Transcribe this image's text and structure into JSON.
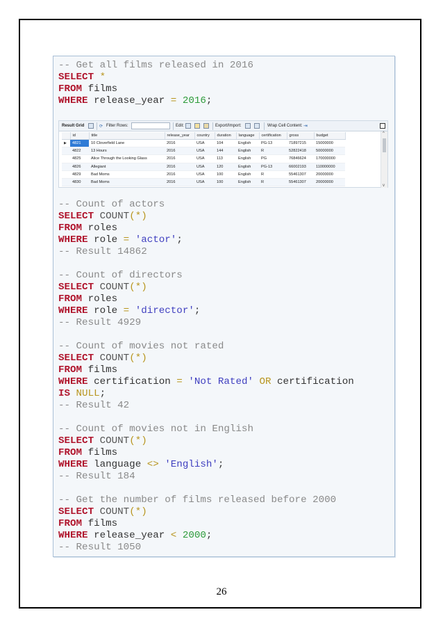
{
  "queries": [
    {
      "comment": "-- Get all films released in 2016"
    },
    {
      "comment": "-- Count of actors",
      "result": "-- Result 14862",
      "string": "'actor'"
    },
    {
      "comment": "-- Count of directors",
      "result": "-- Result 4929",
      "string": "'director'"
    },
    {
      "comment": "-- Count of movies not rated",
      "result": "-- Result 42",
      "string": "'Not Rated'"
    },
    {
      "comment": "-- Count of movies not in English",
      "result": "-- Result 184",
      "string": "'English'"
    },
    {
      "comment": "-- Get the number of films released before 2000",
      "result": "-- Result 1050"
    }
  ],
  "keywords": {
    "select": "SELECT",
    "from": "FROM",
    "where": "WHERE",
    "is": "IS",
    "count": "COUNT",
    "or": "OR",
    "null": "NULL",
    "star": "*"
  },
  "identifiers": {
    "films": "films",
    "roles": "roles",
    "release_year": "release_year",
    "role": "role",
    "certification": "certification",
    "language": "language",
    "year_2016": "2016",
    "year_2000": "2000"
  },
  "result_grid": {
    "toolbar": {
      "result_grid": "Result Grid",
      "filter_rows": "Filter Rows:",
      "edit": "Edit:",
      "export_import": "Export/Import:",
      "wrap_cell": "Wrap Cell Content:"
    },
    "columns": [
      "id",
      "title",
      "release_year",
      "country",
      "duration",
      "language",
      "certification",
      "gross",
      "budget"
    ],
    "rows": [
      [
        "4821",
        "10 Cloverfield Lane",
        "2016",
        "USA",
        "104",
        "English",
        "PG-13",
        "71897215",
        "15000000"
      ],
      [
        "4822",
        "13 Hours",
        "2016",
        "USA",
        "144",
        "English",
        "R",
        "52822418",
        "50000000"
      ],
      [
        "4825",
        "Alice Through the Looking Glass",
        "2016",
        "USA",
        "113",
        "English",
        "PG",
        "76846624",
        "170000000"
      ],
      [
        "4826",
        "Allegiant",
        "2016",
        "USA",
        "120",
        "English",
        "PG-13",
        "66002193",
        "110000000"
      ],
      [
        "4829",
        "Bad Moms",
        "2016",
        "USA",
        "100",
        "English",
        "R",
        "55461307",
        "20000000"
      ],
      [
        "4830",
        "Bad Moms",
        "2016",
        "USA",
        "100",
        "English",
        "R",
        "55461307",
        "20000000"
      ]
    ]
  },
  "page_number": "26"
}
